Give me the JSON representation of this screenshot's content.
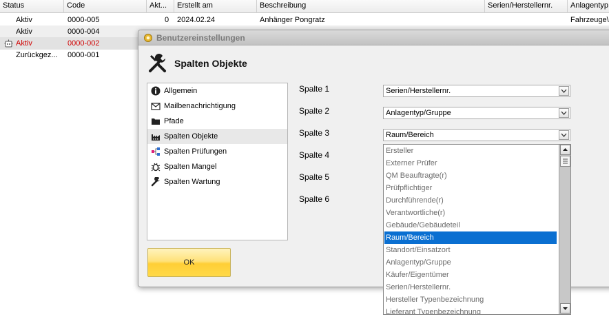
{
  "grid": {
    "columns": [
      "Status",
      "Code",
      "Akt...",
      "Erstellt am",
      "Beschreibung",
      "Serien/Herstellernr.",
      "Anlagentyp"
    ],
    "rows": [
      {
        "status": "Aktiv",
        "code": "0000-005",
        "akt": "0",
        "date": "2024.02.24",
        "desc": "Anhänger Pongratz",
        "anlage": "Fahrzeuge\\"
      },
      {
        "status": "Aktiv",
        "code": "0000-004",
        "akt": "",
        "date": "",
        "desc": "",
        "anlage": ""
      },
      {
        "status": "Aktiv",
        "code": "0000-002",
        "akt": "",
        "date": "",
        "desc": "",
        "anlage": ""
      },
      {
        "status": "Zurückgez...",
        "code": "0000-001",
        "akt": "",
        "date": "",
        "desc": "",
        "anlage": ""
      }
    ]
  },
  "dialog": {
    "title": "Benutzereinstellungen",
    "header": "Spalten Objekte",
    "nav": [
      {
        "label": "Allgemein",
        "icon": "info-icon"
      },
      {
        "label": "Mailbenachrichtigung",
        "icon": "mail-icon"
      },
      {
        "label": "Pfade",
        "icon": "folder-icon"
      },
      {
        "label": "Spalten Objekte",
        "icon": "factory-icon"
      },
      {
        "label": "Spalten Prüfungen",
        "icon": "hierarchy-icon"
      },
      {
        "label": "Spalten Mangel",
        "icon": "bug-icon"
      },
      {
        "label": "Spalten Wartung",
        "icon": "wrench-icon"
      }
    ],
    "fields": [
      {
        "label": "Spalte 1",
        "value": "Serien/Herstellernr."
      },
      {
        "label": "Spalte 2",
        "value": "Anlagentyp/Gruppe"
      },
      {
        "label": "Spalte 3",
        "value": "Raum/Bereich"
      },
      {
        "label": "Spalte 4",
        "value": ""
      },
      {
        "label": "Spalte 5",
        "value": ""
      },
      {
        "label": "Spalte 6",
        "value": ""
      }
    ],
    "ok_label": "OK",
    "dropdown_options": [
      "Ersteller",
      "Externer Prüfer",
      "QM Beauftragte(r)",
      "Prüfpflichtiger",
      "Durchführende(r)",
      "Verantwortliche(r)",
      "Gebäude/Gebäudeteil",
      "Raum/Bereich",
      "Standort/Einsatzort",
      "Anlagentyp/Gruppe",
      "Käufer/Eigentümer",
      "Serien/Herstellernr.",
      "Hersteller Typenbezeichnung",
      "Lieferant Typenbezeichnung"
    ],
    "dropdown_selected": "Raum/Bereich"
  },
  "colors": {
    "accent": "#0a6fd1",
    "inactive_red": "#d00000",
    "ok_button": "#ffd948"
  }
}
